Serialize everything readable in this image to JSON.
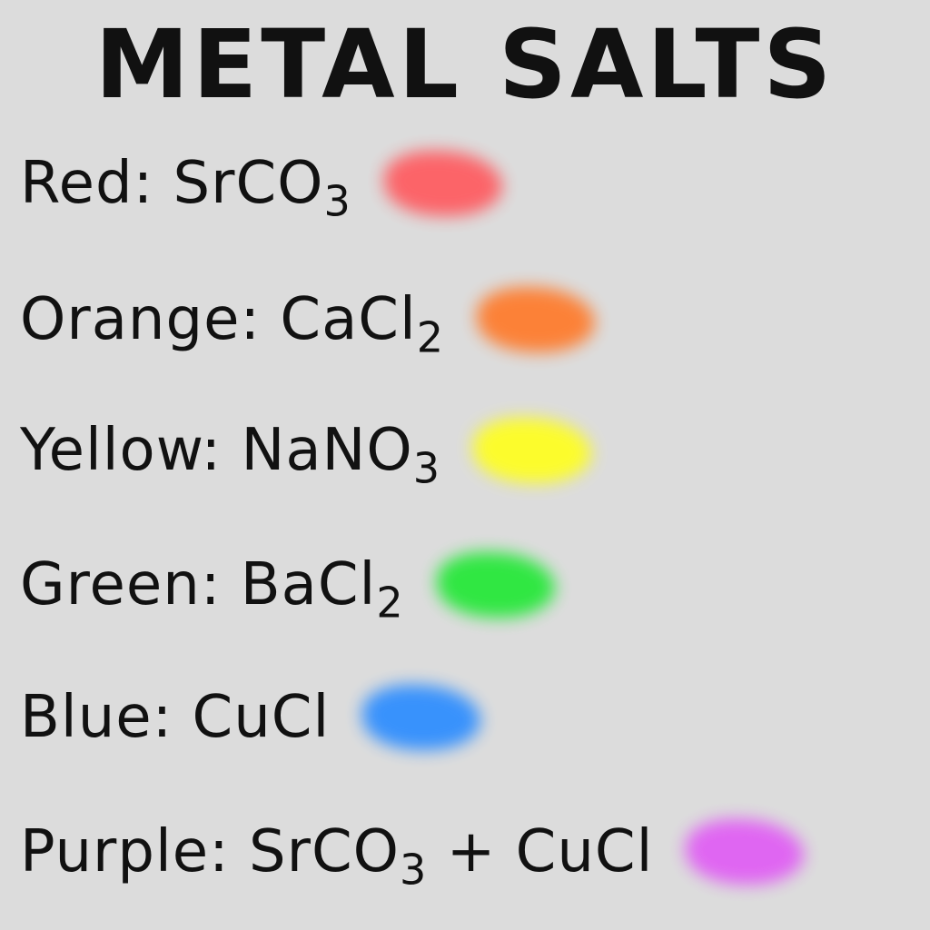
{
  "title": "METAL SALTS",
  "items": [
    {
      "id": "red",
      "color_label": "Red",
      "formula_base": "SrCO",
      "formula_sub": "3",
      "formula_suffix": "",
      "swatch_color": "#ff5a5f"
    },
    {
      "id": "orange",
      "color_label": "Orange",
      "formula_base": "CaCl",
      "formula_sub": "2",
      "formula_suffix": "",
      "swatch_color": "#ff7a2a"
    },
    {
      "id": "yellow",
      "color_label": "Yellow",
      "formula_base": "NaNO",
      "formula_sub": "3",
      "formula_suffix": "",
      "swatch_color": "#ffff1e"
    },
    {
      "id": "green",
      "color_label": "Green",
      "formula_base": "BaCl",
      "formula_sub": "2",
      "formula_suffix": "",
      "swatch_color": "#22e836"
    },
    {
      "id": "blue",
      "color_label": "Blue",
      "formula_base": "CuCl",
      "formula_sub": "",
      "formula_suffix": "",
      "swatch_color": "#2b8cff"
    },
    {
      "id": "purple",
      "color_label": "Purple",
      "formula_base": "SrCO",
      "formula_sub": "3",
      "formula_suffix": " + CuCl",
      "swatch_color": "#e05cf4"
    }
  ]
}
